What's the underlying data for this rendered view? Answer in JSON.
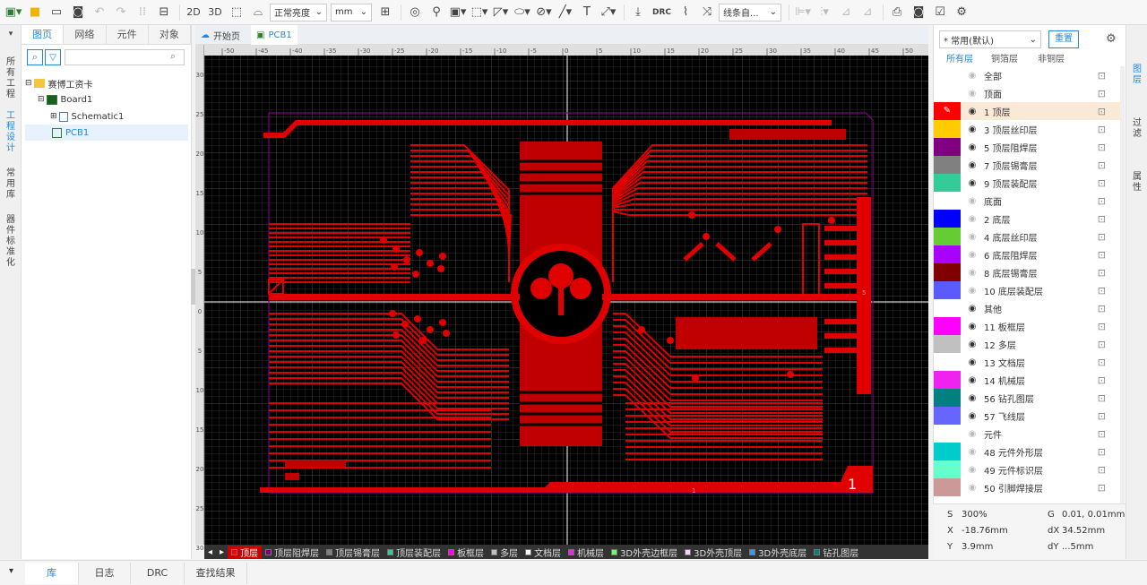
{
  "toolbar": {
    "view_2d": "2D",
    "view_3d": "3D",
    "brightness": "正常亮度",
    "unit": "mm",
    "drc": "DRC",
    "line_mode": "线条自..."
  },
  "left_tabs": [
    "所有工程",
    "工程设计",
    "常用库",
    "器件标准化"
  ],
  "left_panel": {
    "tabs": [
      "图页",
      "网络",
      "元件",
      "对象"
    ],
    "search_placeholder": "",
    "tree": [
      {
        "label": "赛博工资卡"
      },
      {
        "label": "Board1"
      },
      {
        "label": "Schematic1"
      },
      {
        "label": "PCB1"
      }
    ]
  },
  "doc_tabs": [
    {
      "label": "开始页"
    },
    {
      "label": "PCB1"
    }
  ],
  "canvas": {
    "ruler_top": [
      "-50",
      "-45",
      "-40",
      "-35",
      "-30",
      "-25",
      "-20",
      "-15",
      "-10",
      "-5",
      "0",
      "5",
      "10",
      "15",
      "20",
      "25",
      "30",
      "35",
      "40",
      "45",
      "50"
    ],
    "ruler_left": [
      "30",
      "25",
      "20",
      "15",
      "10",
      "5",
      "0",
      "5",
      "10",
      "15",
      "20",
      "25",
      "30"
    ],
    "pin_labels": [
      "5",
      "1",
      "1"
    ]
  },
  "layer_bar": [
    {
      "name": "顶层",
      "color": "#ff0000"
    },
    {
      "name": "顶层阻焊层",
      "color": "#800080"
    },
    {
      "name": "顶层锡膏层",
      "color": "#808080"
    },
    {
      "name": "顶层装配层",
      "color": "#33cc99"
    },
    {
      "name": "板框层",
      "color": "#ff00ff"
    },
    {
      "name": "多层",
      "color": "#c0c0c0"
    },
    {
      "name": "文档层",
      "color": "#ffffff"
    },
    {
      "name": "机械层",
      "color": "#f022f0"
    },
    {
      "name": "3D外壳边框层",
      "color": "#66ff66"
    },
    {
      "name": "3D外壳顶层",
      "color": "#ffccff"
    },
    {
      "name": "3D外壳底层",
      "color": "#3399ff"
    },
    {
      "name": "钻孔图层",
      "color": "#008080"
    }
  ],
  "right_panel": {
    "preset": "* 常用(默认)",
    "reset": "重置",
    "filter_tabs": [
      "所有层",
      "铜箔层",
      "非铜层"
    ],
    "layers": [
      {
        "name": "全部",
        "color": "",
        "group": true,
        "eye": false
      },
      {
        "name": "顶面",
        "color": "",
        "group": true,
        "eye": false
      },
      {
        "name": "1 顶层",
        "color": "#ff0000",
        "eye": true,
        "active": true
      },
      {
        "name": "3 顶层丝印层",
        "color": "#ffcc00",
        "eye": true
      },
      {
        "name": "5 顶层阻焊层",
        "color": "#800080",
        "eye": true
      },
      {
        "name": "7 顶层锡膏层",
        "color": "#808080",
        "eye": true
      },
      {
        "name": "9 顶层装配层",
        "color": "#33cc99",
        "eye": true
      },
      {
        "name": "底面",
        "color": "",
        "group": true,
        "eye": false
      },
      {
        "name": "2 底层",
        "color": "#0000ff",
        "eye": false
      },
      {
        "name": "4 底层丝印层",
        "color": "#66cc33",
        "eye": false
      },
      {
        "name": "6 底层阻焊层",
        "color": "#aa00ff",
        "eye": false
      },
      {
        "name": "8 底层锡膏层",
        "color": "#800000",
        "eye": false
      },
      {
        "name": "10 底层装配层",
        "color": "#5a5aff",
        "eye": false
      },
      {
        "name": "其他",
        "color": "",
        "group": true,
        "eye": true
      },
      {
        "name": "11 板框层",
        "color": "#ff00ff",
        "eye": true
      },
      {
        "name": "12 多层",
        "color": "#c0c0c0",
        "eye": true
      },
      {
        "name": "13 文档层",
        "color": "#ffffff",
        "eye": true
      },
      {
        "name": "14 机械层",
        "color": "#f022f0",
        "eye": true
      },
      {
        "name": "56 钻孔图层",
        "color": "#008080",
        "eye": true
      },
      {
        "name": "57 飞线层",
        "color": "#6666ff",
        "eye": true
      },
      {
        "name": "元件",
        "color": "",
        "group": true,
        "eye": false
      },
      {
        "name": "48 元件外形层",
        "color": "#00cccc",
        "eye": false
      },
      {
        "name": "49 元件标识层",
        "color": "#66ffcc",
        "eye": false
      },
      {
        "name": "50 引脚焊接层",
        "color": "#cc9999",
        "eye": false
      }
    ],
    "status": {
      "s_label": "S",
      "s_value": "300%",
      "g_label": "G",
      "g_value": "0.01, 0.01mm",
      "x_label": "X",
      "x_value": "-18.76mm",
      "dx_label": "dX",
      "dx_value": "34.52mm",
      "y_label": "Y",
      "y_value": "3.9mm",
      "dy_label": "dY",
      "dy_value": "...5mm"
    }
  },
  "right_tabs": [
    "图层",
    "过滤",
    "属性"
  ],
  "bottom_tabs": [
    "库",
    "日志",
    "DRC",
    "查找结果"
  ]
}
